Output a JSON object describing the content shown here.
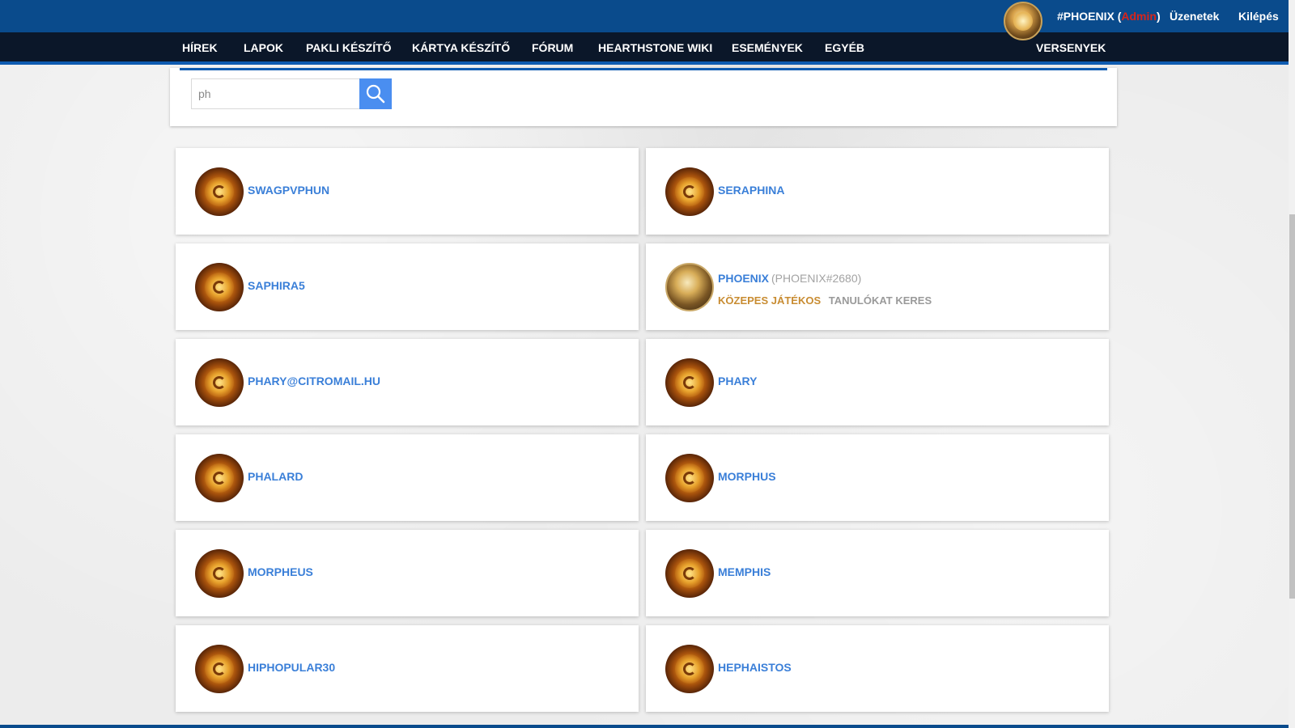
{
  "header": {
    "username": "#PHOENIX",
    "role": "Admin",
    "messages_label": "Üzenetek",
    "logout_label": "Kilépés"
  },
  "nav": {
    "items": [
      "HÍREK",
      "LAPOK",
      "PAKLI KÉSZÍTŐ",
      "KÁRTYA KÉSZÍTŐ",
      "FÓRUM",
      "HEARTHSTONE WIKI",
      "ESEMÉNYEK",
      "EGYÉB"
    ],
    "right_item": "VERSENYEK"
  },
  "search": {
    "value": "ph",
    "icon": "search-icon"
  },
  "results": [
    {
      "name": "SWAGPVPHUN",
      "avatar": "hearthstone-logo-avatar"
    },
    {
      "name": "SERAPHINA",
      "avatar": "hearthstone-logo-avatar"
    },
    {
      "name": "SAPHIRA5",
      "avatar": "hearthstone-logo-avatar"
    },
    {
      "name": "PHOENIX",
      "tag": "(PHOENIX#2680)",
      "level": "KÖZEPES JÁTÉKOS",
      "status": "TANULÓKAT KERES",
      "avatar": "custom-user-avatar"
    },
    {
      "name": "PHARY@CITROMAIL.HU",
      "avatar": "hearthstone-logo-avatar"
    },
    {
      "name": "PHARY",
      "avatar": "hearthstone-logo-avatar"
    },
    {
      "name": "PHALARD",
      "avatar": "hearthstone-logo-avatar"
    },
    {
      "name": "MORPHUS",
      "avatar": "hearthstone-logo-avatar"
    },
    {
      "name": "MORPHEUS",
      "avatar": "hearthstone-logo-avatar"
    },
    {
      "name": "MEMPHIS",
      "avatar": "hearthstone-logo-avatar"
    },
    {
      "name": "HIPHOPULAR30",
      "avatar": "hearthstone-logo-avatar"
    },
    {
      "name": "HEPHAISTOS",
      "avatar": "hearthstone-logo-avatar"
    }
  ],
  "colors": {
    "topbar": "#0a4b8c",
    "navbar": "#0b1729",
    "accent": "#0e5bb0",
    "link": "#3a7fd8",
    "role": "#d8241b",
    "level_badge": "#c88c32",
    "status_badge": "#9a9a9a",
    "search_button": "#4a8ef0"
  }
}
